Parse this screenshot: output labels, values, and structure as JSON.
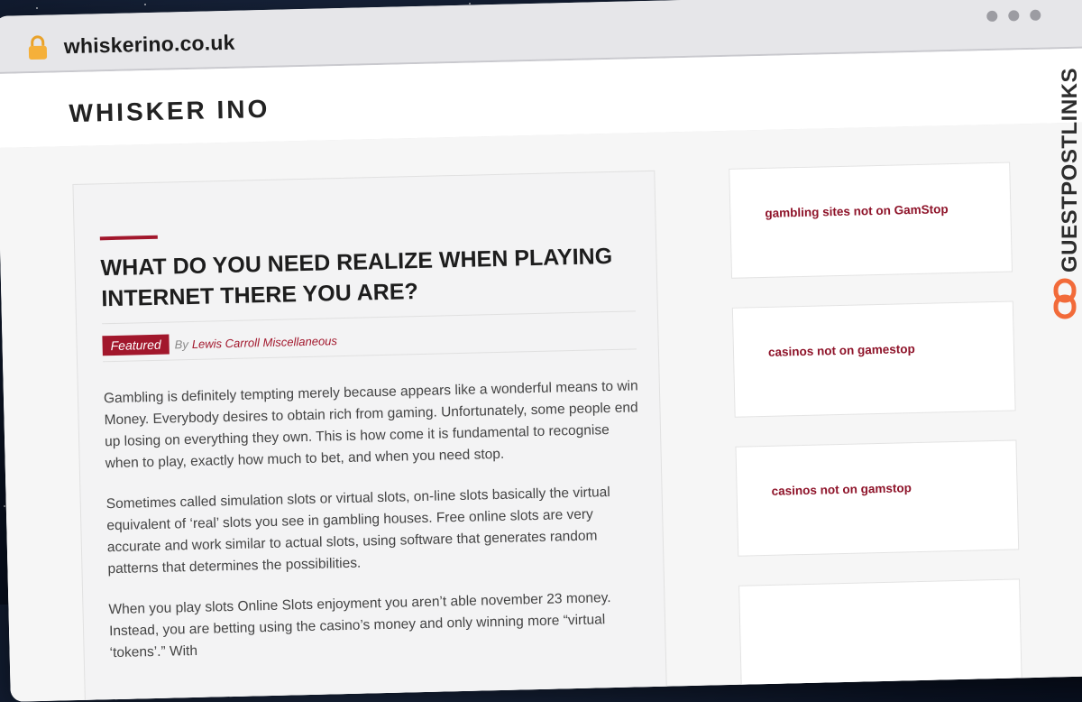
{
  "browser": {
    "url": "whiskerino.co.uk",
    "lock_icon": "lock-icon",
    "window_controls": [
      "dot",
      "dot",
      "dot"
    ]
  },
  "site": {
    "title": "WHISKER INO"
  },
  "article": {
    "title": "WHAT DO YOU NEED REALIZE WHEN PLAYING INTERNET THERE YOU ARE?",
    "badge": "Featured",
    "by_label": "By",
    "author": "Lewis Carroll Miscellaneous",
    "paragraphs": [
      "Gambling is definitely tempting merely because appears like a wonderful means to win Money. Everybody desires to obtain rich from gaming. Unfortunately, some people end up losing on everything they own. This is how come it is fundamental to recognise when to play, exactly how much to bet, and when you need stop.",
      "Sometimes called simulation slots or virtual slots, on-line slots basically the virtual equivalent of ‘real’ slots you see in gambling houses. Free online slots are very accurate and work similar to actual slots, using software that generates random patterns that determines the possibilities.",
      "When you play slots Online Slots enjoyment you aren’t able november 23 money. Instead, you are betting using the casino’s money and only winning more “virtual ‘tokens’.” With"
    ]
  },
  "sidebar": {
    "links": [
      "gambling sites not on GamStop",
      "casinos not on gamestop",
      "casinos not on gamstop"
    ]
  },
  "watermark": {
    "text": "GUESTPOSTLINKS",
    "icon": "link-icon",
    "accent_color": "#f26b3a"
  },
  "colors": {
    "accent": "#a2172c",
    "link": "#8e1329"
  }
}
